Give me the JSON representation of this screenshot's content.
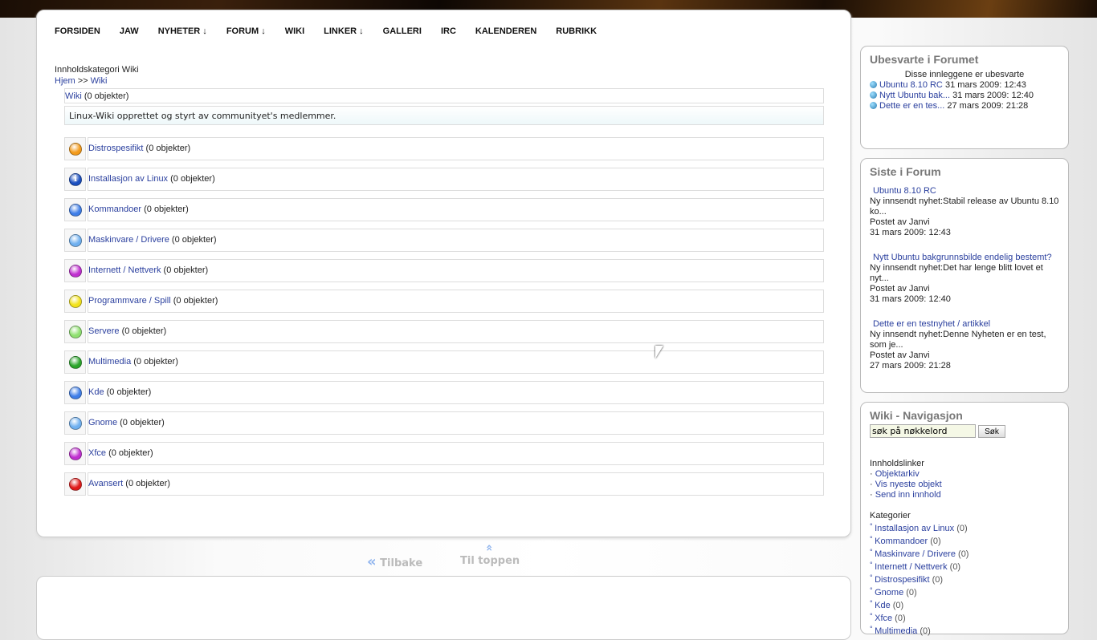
{
  "nav": [
    "FORSIDEN",
    "JAW",
    "NYHETER ↓",
    "FORUM ↓",
    "WIKI",
    "LINKER ↓",
    "GALLERI",
    "IRC",
    "KALENDEREN",
    "RUBRIKK"
  ],
  "page": {
    "title": "Innholdskategori Wiki",
    "crumb_home": "Hjem",
    "crumb_sep": " >> ",
    "crumb_wiki": "Wiki",
    "header_link": "Wiki",
    "header_count": " (0 objekter)",
    "description": "Linux-Wiki opprettet og styrt av communityet's medlemmer."
  },
  "categories": [
    {
      "name": "Distrospesifikt",
      "count": " (0 objekter)",
      "color": "#f39a1a"
    },
    {
      "name": "Installasjon av Linux",
      "count": " (0 objekter)",
      "color": "#1b4fbf"
    },
    {
      "name": "Kommandoer",
      "count": " (0 objekter)",
      "color": "#3f7ee8"
    },
    {
      "name": "Maskinvare / Drivere",
      "count": " (0 objekter)",
      "color": "#6fb0f0"
    },
    {
      "name": "Internett / Nettverk",
      "count": " (0 objekter)",
      "color": "#c02fd0"
    },
    {
      "name": "Programmvare / Spill",
      "count": " (0 objekter)",
      "color": "#f2e21a"
    },
    {
      "name": "Servere",
      "count": " (0 objekter)",
      "color": "#8fe070"
    },
    {
      "name": "Multimedia",
      "count": " (0 objekter)",
      "color": "#2aa52a"
    },
    {
      "name": "Kde",
      "count": " (0 objekter)",
      "color": "#3f7ee8"
    },
    {
      "name": "Gnome",
      "count": " (0 objekter)",
      "color": "#6fb0f0"
    },
    {
      "name": "Xfce",
      "count": " (0 objekter)",
      "color": "#c02fd0"
    },
    {
      "name": "Avansert",
      "count": " (0 objekter)",
      "color": "#e01a1a"
    }
  ],
  "bottom_nav": {
    "back": "Tilbake",
    "top": "Til toppen"
  },
  "unanswered": {
    "title": "Ubesvarte i Forumet",
    "subtitle": "Disse innleggene er ubesvarte",
    "items": [
      {
        "link": "Ubuntu 8.10 RC",
        "date": " 31 mars 2009: 12:43"
      },
      {
        "link": "Nytt Ubuntu bak...",
        "date": " 31 mars 2009: 12:40"
      },
      {
        "link": "Dette er en tes...",
        "date": " 27 mars 2009: 21:28"
      }
    ]
  },
  "latest": {
    "title": "Siste i Forum",
    "items": [
      {
        "link": "Ubuntu 8.10 RC",
        "text": "Ny innsendt nyhet:Stabil release av Ubuntu 8.10 ko...",
        "by": "Postet av Janvi",
        "date": "31 mars 2009: 12:43"
      },
      {
        "link": "Nytt Ubuntu bakgrunnsbilde endelig bestemt?",
        "text": "Ny innsendt nyhet:Det har lenge blitt lovet et nyt...",
        "by": "Postet av Janvi",
        "date": "31 mars 2009: 12:40"
      },
      {
        "link": "Dette er en testnyhet / artikkel",
        "text": "Ny innsendt nyhet:Denne Nyheten er en test, som je...",
        "by": "Postet av Janvi",
        "date": "27 mars 2009: 21:28"
      }
    ]
  },
  "wikinav": {
    "title": "Wiki - Navigasjon",
    "search_value": "søk på nøkkelord",
    "search_button": "Søk",
    "links_title": "Innholdslinker",
    "links": [
      "Objektarkiv",
      "Vis nyeste objekt",
      "Send inn innhold"
    ],
    "cats_title": "Kategorier",
    "cats": [
      {
        "name": "Installasjon av Linux",
        "count": " (0)"
      },
      {
        "name": "Kommandoer",
        "count": " (0)"
      },
      {
        "name": "Maskinvare / Drivere",
        "count": " (0)"
      },
      {
        "name": "Internett / Nettverk",
        "count": " (0)"
      },
      {
        "name": "Distrospesifikt",
        "count": " (0)"
      },
      {
        "name": "Gnome",
        "count": " (0)"
      },
      {
        "name": "Kde",
        "count": " (0)"
      },
      {
        "name": "Xfce",
        "count": " (0)"
      },
      {
        "name": "Multimedia",
        "count": " (0)"
      }
    ]
  }
}
